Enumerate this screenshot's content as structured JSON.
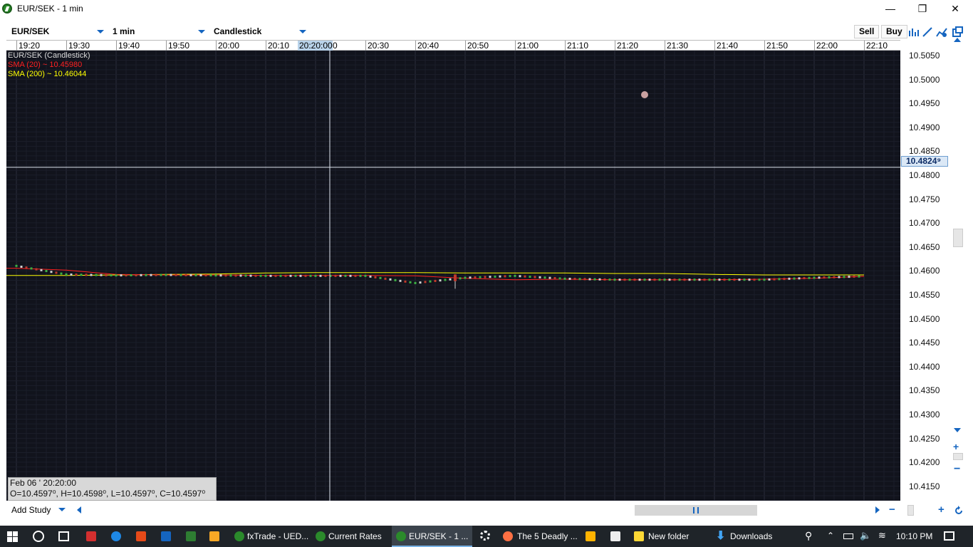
{
  "window": {
    "title": "EUR/SEK - 1 min",
    "minimize_label": "—",
    "restore_label": "❐",
    "close_label": "✕"
  },
  "toolbar": {
    "instrument": "EUR/SEK",
    "interval": "1 min",
    "chart_type": "Candlestick",
    "sell_label": "Sell",
    "buy_label": "Buy"
  },
  "time_axis": {
    "labels": [
      "19:20",
      "19:30",
      "19:40",
      "19:50",
      "20:00",
      "20:10",
      "20:20:00",
      "0",
      "20:30",
      "20:40",
      "20:50",
      "21:00",
      "21:10",
      "21:20",
      "21:30",
      "21:40",
      "21:50",
      "22:00",
      "22:10"
    ]
  },
  "legend": {
    "title": "EUR/SEK (Candlestick)",
    "sma20": "SMA (20) ~ 10.45980",
    "sma200": "SMA (200) ~ 10.46044"
  },
  "ohlc_box": {
    "date": "Feb 06 ' 20:20:00",
    "values": "O=10.4597⁰, H=10.4598⁰, L=10.4597⁰, C=10.4597⁰"
  },
  "price_axis": {
    "labels": [
      "10.5050",
      "10.5000",
      "10.4950",
      "10.4900",
      "10.4850",
      "10.4800",
      "10.4750",
      "10.4700",
      "10.4650",
      "10.4600",
      "10.4550",
      "10.4500",
      "10.4450",
      "10.4400",
      "10.4350",
      "10.4300",
      "10.4250",
      "10.4200",
      "10.4150"
    ],
    "current": "10.4824⁹"
  },
  "bottom_bar": {
    "add_study": "Add Study"
  },
  "taskbar": {
    "items": [
      {
        "label": "fxTrade - UED..."
      },
      {
        "label": "Current Rates"
      },
      {
        "label": "EUR/SEK - 1 ..."
      },
      {
        "label": "The 5 Deadly ..."
      },
      {
        "label": "New folder"
      },
      {
        "label": "Downloads"
      }
    ],
    "clock": "10:10 PM"
  },
  "colors": {
    "chart_bg": "#11131c",
    "sma20": "#ff2020",
    "sma200": "#ffff00",
    "crosshair": "#dfe6f0"
  },
  "chart_data": {
    "type": "candlestick",
    "title": "EUR/SEK (Candlestick)",
    "ylim": [
      10.4125,
      10.507
    ],
    "x_ticks": [
      "19:20",
      "19:30",
      "19:40",
      "19:50",
      "20:00",
      "20:10",
      "20:20",
      "20:30",
      "20:40",
      "20:50",
      "21:00",
      "21:10",
      "21:20",
      "21:30",
      "21:40",
      "21:50",
      "22:00",
      "22:10"
    ],
    "series": [
      {
        "name": "SMA (20) ~ 10.45980",
        "x": [
          "19:20",
          "19:30",
          "19:40",
          "19:50",
          "20:00",
          "20:10",
          "20:20",
          "20:30",
          "20:40",
          "20:50",
          "21:00",
          "21:10",
          "21:20",
          "21:30",
          "21:40",
          "21:50",
          "22:00",
          "22:10"
        ],
        "values": [
          10.4613,
          10.4609,
          10.46,
          10.4599,
          10.4599,
          10.4598,
          10.4598,
          10.4598,
          10.4597,
          10.4592,
          10.4589,
          10.459,
          10.4589,
          10.4589,
          10.4589,
          10.459,
          10.4592,
          10.4596
        ]
      },
      {
        "name": "SMA (200) ~ 10.46044",
        "x": [
          "19:20",
          "19:30",
          "19:40",
          "19:50",
          "20:00",
          "20:10",
          "20:20",
          "20:30",
          "20:40",
          "20:50",
          "21:00",
          "21:10",
          "21:20",
          "21:30",
          "21:40",
          "21:50",
          "22:00",
          "22:10"
        ],
        "values": [
          10.4598,
          10.4598,
          10.4599,
          10.46,
          10.4601,
          10.4603,
          10.4604,
          10.4604,
          10.4604,
          10.4603,
          10.4603,
          10.4603,
          10.4602,
          10.4602,
          10.46,
          10.4599,
          10.4599,
          10.4599
        ]
      },
      {
        "name": "EUR/SEK close",
        "x": [
          "19:20",
          "19:30",
          "19:40",
          "19:50",
          "20:00",
          "20:10",
          "20:20",
          "20:30",
          "20:40",
          "20:50",
          "21:00",
          "21:10",
          "21:20",
          "21:30",
          "21:40",
          "21:50",
          "22:00",
          "22:10"
        ],
        "values": [
          10.4618,
          10.46,
          10.4598,
          10.4599,
          10.4598,
          10.4597,
          10.4597,
          10.4597,
          10.4582,
          10.4593,
          10.4597,
          10.4591,
          10.4589,
          10.4589,
          10.4589,
          10.4589,
          10.4593,
          10.4596
        ]
      }
    ],
    "crosshair": {
      "time": "20:20:00",
      "price": "10.4824⁹"
    },
    "grid": true
  }
}
